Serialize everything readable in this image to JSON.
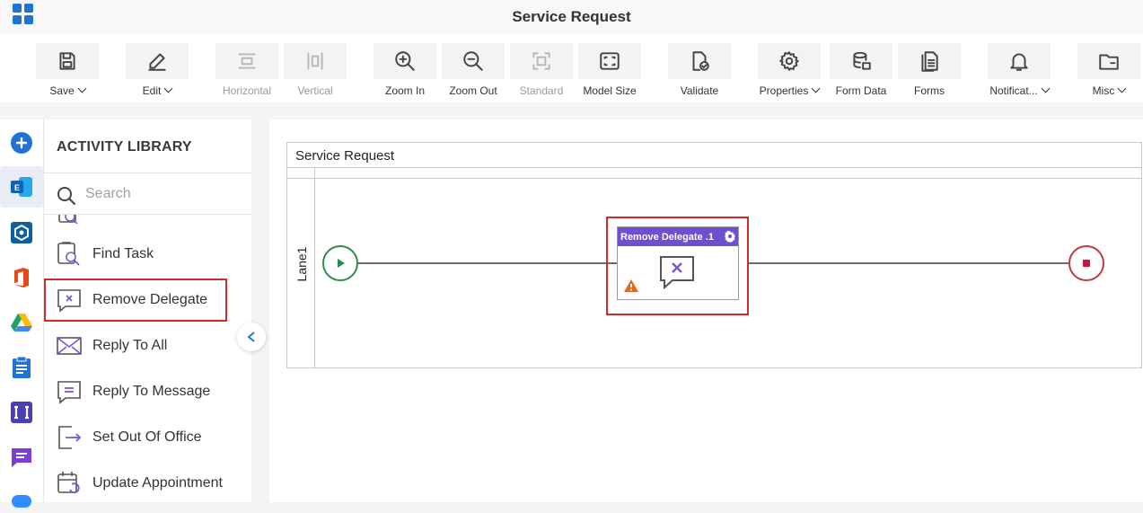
{
  "app": {
    "title": "Service Request"
  },
  "toolbar": {
    "save": "Save",
    "edit": "Edit",
    "horizontal": "Horizontal",
    "vertical": "Vertical",
    "zoom_in": "Zoom In",
    "zoom_out": "Zoom Out",
    "standard": "Standard",
    "model_size": "Model Size",
    "validate": "Validate",
    "properties": "Properties",
    "form_data": "Form Data",
    "forms": "Forms",
    "notifications": "Notificat...",
    "misc": "Misc"
  },
  "library": {
    "title": "ACTIVITY LIBRARY",
    "search_placeholder": "Search",
    "items": [
      {
        "label": "Find Task",
        "icon": "find-task-icon"
      },
      {
        "label": "Remove Delegate",
        "icon": "remove-delegate-icon",
        "selected": true
      },
      {
        "label": "Reply To All",
        "icon": "reply-to-all-icon"
      },
      {
        "label": "Reply To Message",
        "icon": "reply-to-message-icon"
      },
      {
        "label": "Set Out Of Office",
        "icon": "set-out-of-office-icon"
      },
      {
        "label": "Update Appointment",
        "icon": "update-appointment-icon"
      }
    ]
  },
  "canvas": {
    "pool_title": "Service Request",
    "lane_label": "Lane1",
    "task_label": "Remove Delegate .1"
  },
  "colors": {
    "accent": "#1f74d1",
    "task_header": "#6e4fd1",
    "start_event": "#2e8a4a",
    "end_event": "#c0393b",
    "highlight": "#d12a2a"
  }
}
